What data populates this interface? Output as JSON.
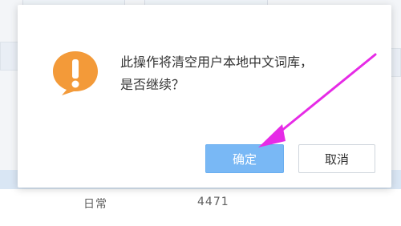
{
  "dialog": {
    "message_line1": "此操作将清空用户本地中文词库，",
    "message_line2": "是否继续？",
    "ok_label": "确定",
    "cancel_label": "取消",
    "icon": "warning-exclamation-icon",
    "icon_color": "#F39A39"
  },
  "background": {
    "row_col1": "日常",
    "row_col2": "4471"
  },
  "colors": {
    "primary_button": "#79B8F5",
    "annotation_arrow": "#E62BE6"
  }
}
